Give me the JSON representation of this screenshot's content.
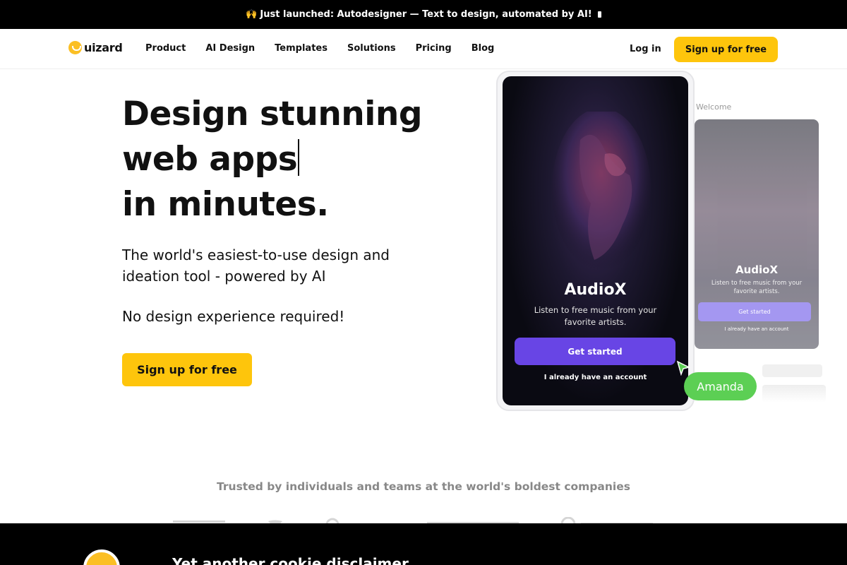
{
  "announcement": {
    "emoji": "🙌",
    "text": "Just launched: Autodesigner — Text to design, automated by AI!"
  },
  "nav": {
    "logo": "uizard",
    "links": [
      "Product",
      "AI Design",
      "Templates",
      "Solutions",
      "Pricing",
      "Blog"
    ],
    "login": "Log in",
    "signup": "Sign up for free"
  },
  "hero": {
    "title_line1": "Design stunning",
    "title_line2": "web apps",
    "title_line3": "in minutes.",
    "subtitle": "The world's easiest-to-use design and ideation tool - powered by AI",
    "note": "No design experience required!",
    "cta": "Sign up for free"
  },
  "mockup": {
    "front": {
      "title": "AudioX",
      "subtitle": "Listen to free music from your favorite artists.",
      "button": "Get started",
      "link": "I already have an account"
    },
    "back": {
      "welcome": "Welcome",
      "title": "AudioX",
      "subtitle": "Listen to free music from your favorite artists.",
      "button": "Get started",
      "link": "I already have an account"
    },
    "collaborator": "Amanda"
  },
  "trusted": {
    "text": "Trusted by individuals and teams at the world's boldest companies"
  },
  "cookie": {
    "title": "Yet another cookie disclaimer"
  },
  "colors": {
    "accent": "#fec50c",
    "primary_button": "#6845e5",
    "collaborator": "#5ccf54"
  }
}
